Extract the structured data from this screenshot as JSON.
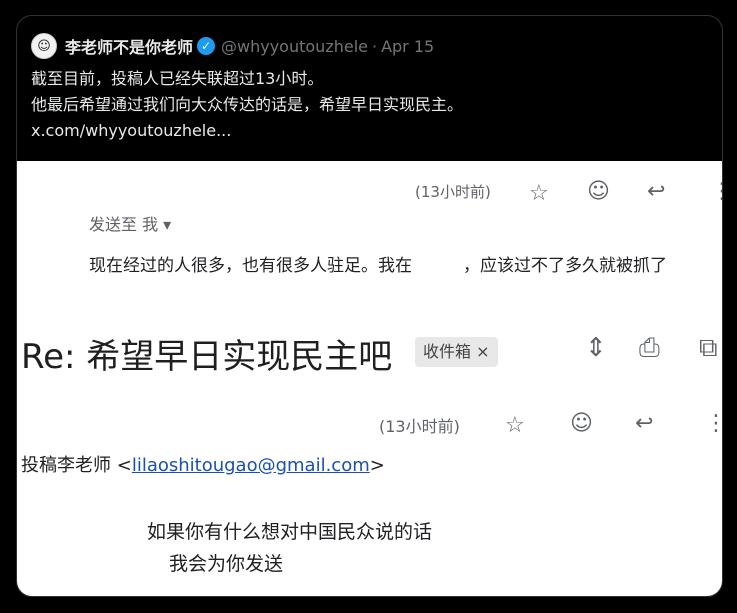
{
  "post": {
    "avatar_glyph": "☺",
    "display_name": "李老师不是你老师",
    "verified_glyph": "✓",
    "handle": "@whyyoutouzhele",
    "separator": "·",
    "date": "Apr 15",
    "text_lines": [
      "截至目前，投稿人已经失联超过13小时。",
      "他最后希望通过我们向大众传达的话是，希望早日实现民主。",
      "x.com/whyyoutouzhele..."
    ]
  },
  "screenshot": {
    "message1": {
      "time": "(13小时前)",
      "to_line": "发送至 我 ▾",
      "body": "现在经过的人很多，也有很多人驻足。我在　　　，应该过不了多久就被抓了"
    },
    "thread": {
      "subject": "Re: 希望早日实现民主吧",
      "label_chip": "收件箱 ×"
    },
    "message2": {
      "time": "(13小时前)",
      "sender_name": "投稿李老师 <",
      "sender_email": "lilaoshitougao@gmail.com",
      "sender_close": ">",
      "body_lines": [
        "如果你有什么想对中国民众说的话",
        "我会为你发送"
      ]
    },
    "icons": [
      "star-icon",
      "emoji-icon",
      "reply-icon",
      "more-icon",
      "expand-icon",
      "print-icon",
      "open-new-window-icon"
    ]
  }
}
